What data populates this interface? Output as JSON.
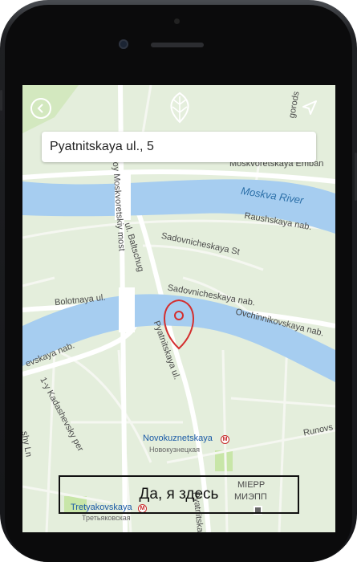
{
  "search": {
    "value": "Pyatnitskaya ul., 5"
  },
  "confirm_button": {
    "label": "Да, я здесь"
  },
  "map": {
    "river_label": "Moskva River",
    "streets": {
      "moskvoretskaya": "Moskvoretskaya Emban",
      "raushskaya": "Raushskaya nab.",
      "sadovnicheskaya_st": "Sadovnicheskaya St",
      "sadovnicheskaya_nab": "Sadovnicheskaya nab.",
      "ovchinnikovskaya": "Ovchinnikovskaya nab.",
      "bolotnaya": "Bolotnaya ul.",
      "bolshoy_most": "Bolshoy Moskvoretskiy most",
      "baltschug": "ul. Baltschug",
      "pyatnitskaya": "Pyatnitskaya ul.",
      "pyatnitskaya_2": "Pyatnitskay",
      "kadashevsky": "1-y Kadashevsky per",
      "vskaya": "evskaya nab.",
      "lavrushinsky": "shy Ln",
      "runov": "Runovs",
      "gorods": "gorods"
    },
    "pois": {
      "novokuznetskaya": "Novokuznetskaya",
      "novokuznetskaya_ru": "Новокузнецкая",
      "tretyakovskaya": "Tretyakovskaya",
      "tretyakovskaya_ru": "Третьяковская",
      "mierr": "MIEPP",
      "mierr_ru": "МИЭПП"
    },
    "metro_symbol": "M"
  },
  "colors": {
    "water": "#a6cdf0",
    "land": "#e4eedc",
    "pin": "#d32f2f",
    "park": "#c8e6a8"
  }
}
